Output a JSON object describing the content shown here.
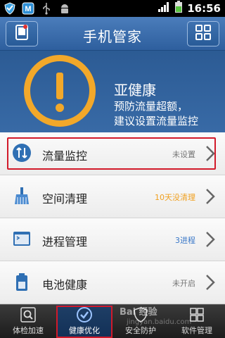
{
  "statusbar": {
    "time": "16:56",
    "icons": [
      "shield-icon",
      "m-badge-icon",
      "usb-icon",
      "android-icon",
      "signal-icon",
      "battery-icon"
    ]
  },
  "header": {
    "title": "手机管家",
    "left_icon": "phone-icon",
    "right_icon": "grid-icon"
  },
  "hero": {
    "title": "亚健康",
    "line1": "预防流量超额，",
    "line2": "建议设置流量监控",
    "accent": "#f2a82a"
  },
  "list": {
    "items": [
      {
        "label": "流量监控",
        "status": "未设置",
        "status_color": "#777777",
        "icon": "traffic-icon"
      },
      {
        "label": "空间清理",
        "status": "10天没清理",
        "status_color": "#f0a020",
        "icon": "broom-icon"
      },
      {
        "label": "进程管理",
        "status": "3进程",
        "status_color": "#3a78c8",
        "icon": "terminal-icon"
      },
      {
        "label": "电池健康",
        "status": "未开启",
        "status_color": "#777777",
        "icon": "battery-health-icon"
      }
    ]
  },
  "bottomnav": {
    "tabs": [
      {
        "label": "体检加速",
        "icon": "scan-icon"
      },
      {
        "label": "健康优化",
        "icon": "check-icon"
      },
      {
        "label": "安全防护",
        "icon": "shield-tab-icon"
      },
      {
        "label": "软件管理",
        "icon": "apps-icon"
      }
    ],
    "active_index": 1
  },
  "watermark": {
    "brand": "Bai 经验",
    "url": "jingyan.baidu.com"
  },
  "colors": {
    "header_blue": "#2e5f9e",
    "highlight_red": "#d21a2a"
  }
}
